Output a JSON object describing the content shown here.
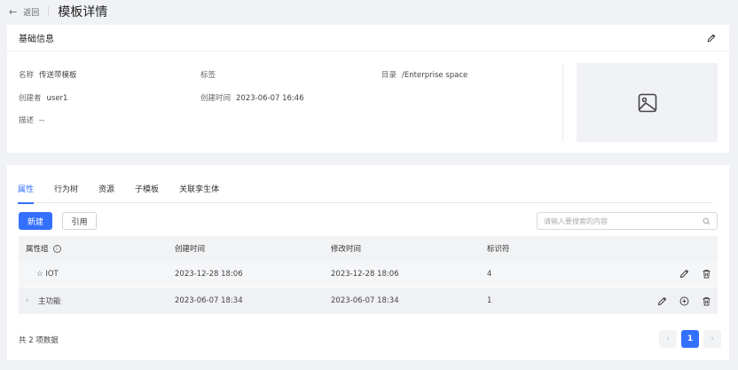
{
  "topbar": {
    "back_label": "返回",
    "title": "模板详情"
  },
  "info": {
    "section_title": "基础信息",
    "name_label": "名称",
    "name_value": "传送带模板",
    "tag_label": "标签",
    "tag_value": "",
    "dir_label": "目录",
    "dir_value": "/Enterprise space",
    "creator_label": "创建者",
    "creator_value": "user1",
    "created_label": "创建时间",
    "created_value": "2023-06-07 16:46",
    "desc_label": "描述",
    "desc_value": "--"
  },
  "tabs": [
    {
      "label": "属性",
      "active": true
    },
    {
      "label": "行为树",
      "active": false
    },
    {
      "label": "资源",
      "active": false
    },
    {
      "label": "子模板",
      "active": false
    },
    {
      "label": "关联孪生体",
      "active": false
    }
  ],
  "toolbar": {
    "new_label": "新建",
    "ref_label": "引用",
    "search_placeholder": "请输入要搜索的内容"
  },
  "table": {
    "headers": {
      "group": "属性组",
      "created": "创建时间",
      "modified": "修改时间",
      "identifier": "标识符"
    },
    "rows": [
      {
        "name": "☆ IOT",
        "created": "2023-12-28 18:06",
        "modified": "2023-12-28 18:06",
        "identifier": "4"
      },
      {
        "name": "主功能",
        "created": "2023-06-07 18:34",
        "modified": "2023-06-07 18:34",
        "identifier": "1"
      }
    ]
  },
  "footer": {
    "total": "共 2 项数据",
    "current_page": "1"
  },
  "colors": {
    "accent": "#3370ff",
    "page_bg": "#f0f2f5"
  }
}
